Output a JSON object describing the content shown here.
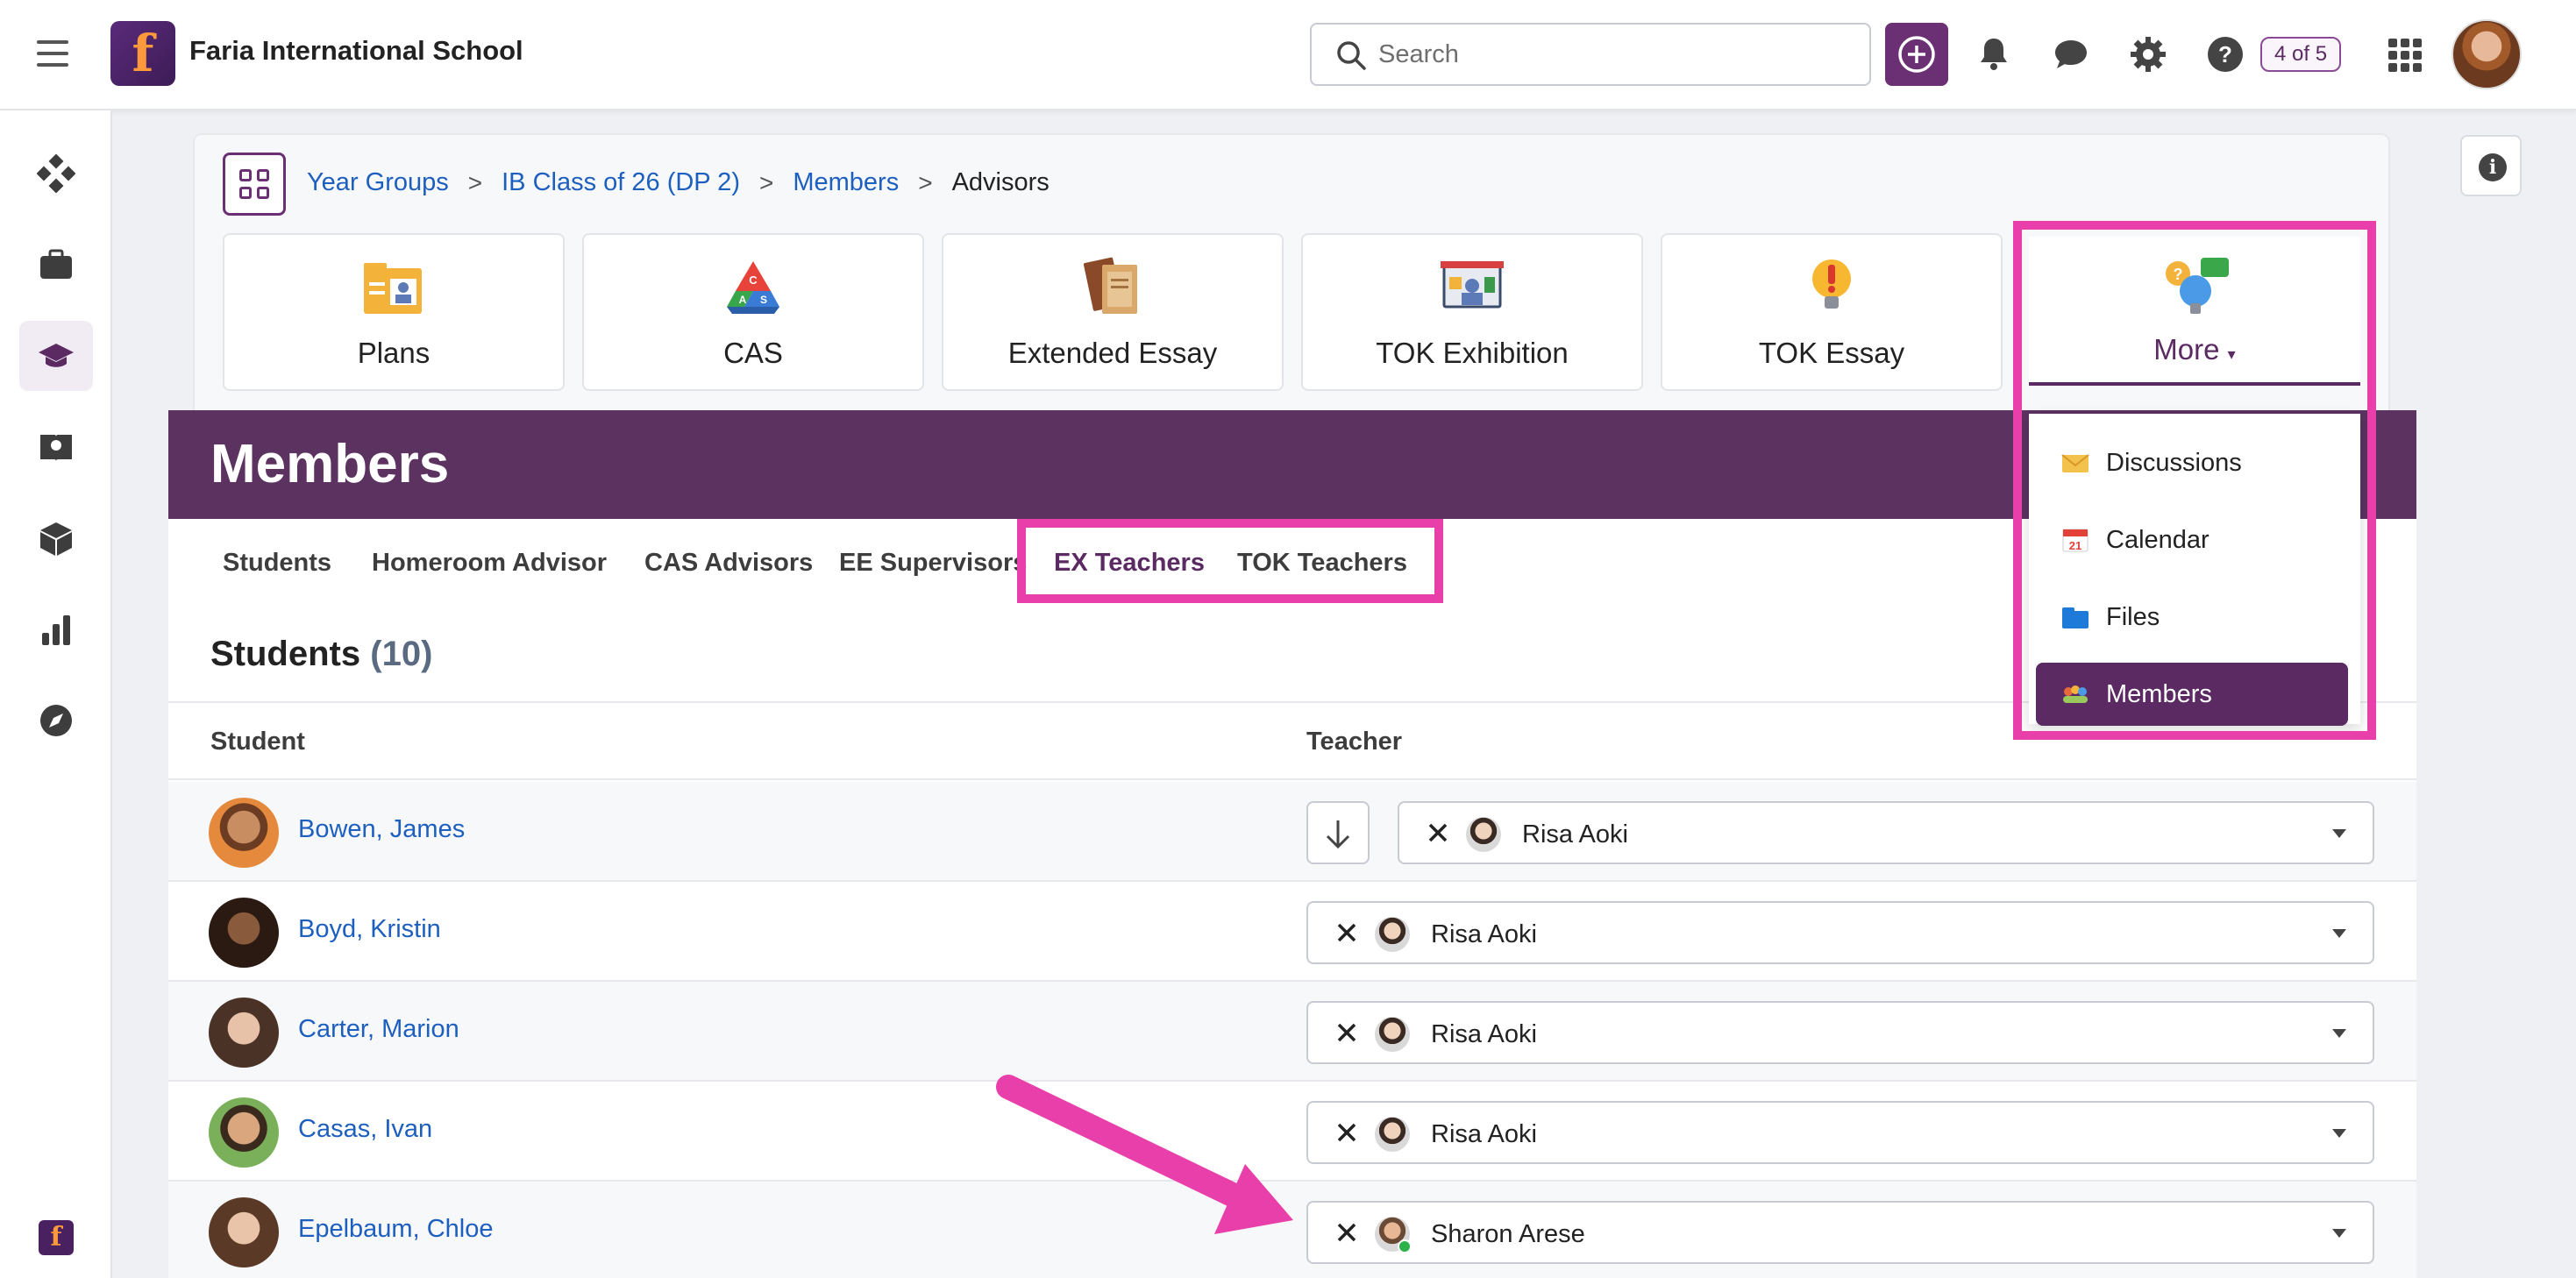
{
  "topbar": {
    "logo_letter": "f",
    "school_name": "Faria International School",
    "search_placeholder": "Search",
    "notification_count": "4 of 5"
  },
  "sidebar": {
    "items": [
      "dashboard",
      "briefcase",
      "graduation-cap",
      "globe-book",
      "cube",
      "bar-chart",
      "compass"
    ],
    "logo_letter": "f"
  },
  "breadcrumb": {
    "items": [
      "Year Groups",
      "IB Class of 26 (DP 2)",
      "Members"
    ],
    "current": "Advisors"
  },
  "tiles": [
    {
      "label": "Plans",
      "icon": "plans-icon"
    },
    {
      "label": "CAS",
      "icon": "cas-icon"
    },
    {
      "label": "Extended Essay",
      "icon": "extended-essay-icon"
    },
    {
      "label": "TOK Exhibition",
      "icon": "tok-exhibition-icon"
    },
    {
      "label": "TOK Essay",
      "icon": "tok-essay-icon"
    }
  ],
  "more": {
    "label": "More",
    "menu": [
      {
        "label": "Discussions",
        "icon": "envelope-icon"
      },
      {
        "label": "Calendar",
        "icon": "calendar-icon"
      },
      {
        "label": "Files",
        "icon": "folder-icon"
      },
      {
        "label": "Members",
        "icon": "members-icon",
        "active": true
      }
    ]
  },
  "panel": {
    "title": "Members",
    "subtabs": [
      "Students",
      "Homeroom Advisor",
      "CAS Advisors",
      "EE Supervisors",
      "EX Teachers",
      "TOK Teachers"
    ],
    "active_subtab": "EX Teachers",
    "section_title": "Students",
    "section_count": "(10)",
    "columns": [
      "Student",
      "Teacher"
    ],
    "rows": [
      {
        "student": "Bowen, James",
        "teacher": "Risa Aoki"
      },
      {
        "student": "Boyd, Kristin",
        "teacher": "Risa Aoki"
      },
      {
        "student": "Carter, Marion",
        "teacher": "Risa Aoki"
      },
      {
        "student": "Casas, Ivan",
        "teacher": "Risa Aoki"
      },
      {
        "student": "Epelbaum, Chloe",
        "teacher": "Sharon Arese"
      }
    ]
  },
  "colors": {
    "brand_purple": "#5b3260",
    "highlight_pink": "#e83faa",
    "link_blue": "#1d5fbf"
  }
}
